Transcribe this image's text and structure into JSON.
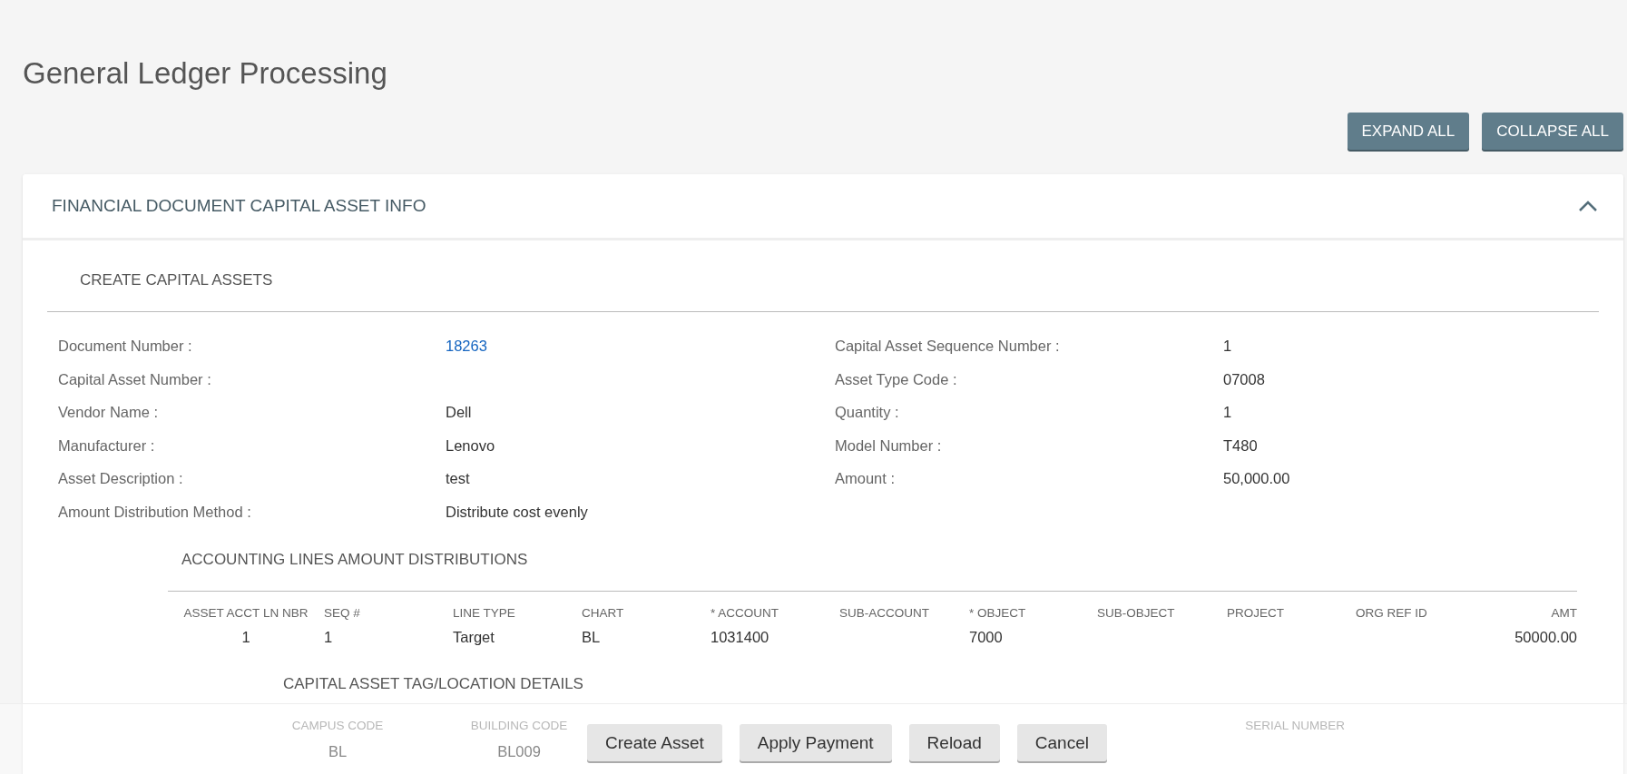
{
  "page_title": "General Ledger Processing",
  "toolbar_buttons": [
    "EXPAND ALL",
    "COLLAPSE ALL"
  ],
  "section": {
    "title": "FINANCIAL DOCUMENT CAPITAL ASSET INFO",
    "expanded": true,
    "subsection_title": "CREATE CAPITAL ASSETS",
    "fields": [
      {
        "label": "Document Number :",
        "value": "18263",
        "kind": "link"
      },
      {
        "label": "Capital Asset Sequence Number :",
        "value": "1",
        "kind": "text"
      },
      {
        "label": "Capital Asset Number :"
      },
      {
        "label": "Asset Type Code :",
        "value": "07008",
        "kind": "text"
      },
      {
        "label": "Vendor Name :",
        "value": "Dell",
        "kind": "text"
      },
      {
        "label": "Quantity :",
        "value": "1",
        "kind": "text"
      },
      {
        "label": "Manufacturer :",
        "value": "Lenovo",
        "kind": "text"
      },
      {
        "label": "Model Number :",
        "value": "T480",
        "kind": "text"
      },
      {
        "label": "Asset Description :",
        "value": "test",
        "kind": "text"
      },
      {
        "label": "Amount :",
        "value": "50,000.00",
        "kind": "text"
      },
      {
        "label": "Amount Distribution Method :",
        "value": "Distribute cost evenly",
        "kind": "text"
      }
    ],
    "distributions": {
      "title": "ACCOUNTING LINES AMOUNT DISTRIBUTIONS",
      "columns": [
        "ASSET ACCT LN NBR",
        "SEQ #",
        "LINE TYPE",
        "CHART",
        "* ACCOUNT",
        "SUB-ACCOUNT",
        "* OBJECT",
        "SUB-OBJECT",
        "PROJECT",
        "ORG REF ID",
        "AMT"
      ],
      "rows": [
        [
          "1",
          "1",
          "Target",
          "BL",
          "1031400",
          "",
          "7000",
          "",
          "",
          "",
          "50000.00"
        ]
      ]
    },
    "location": {
      "title": "CAPITAL ASSET TAG/LOCATION DETAILS",
      "columns": [
        {
          "header": "CAMPUS CODE",
          "value": "BL"
        },
        {
          "header": "BUILDING CODE",
          "value": "BL009"
        },
        {
          "header": "SERIAL NUMBER"
        }
      ]
    }
  },
  "footer_buttons": [
    "Create Asset",
    "Apply Payment",
    "Reload",
    "Cancel"
  ]
}
